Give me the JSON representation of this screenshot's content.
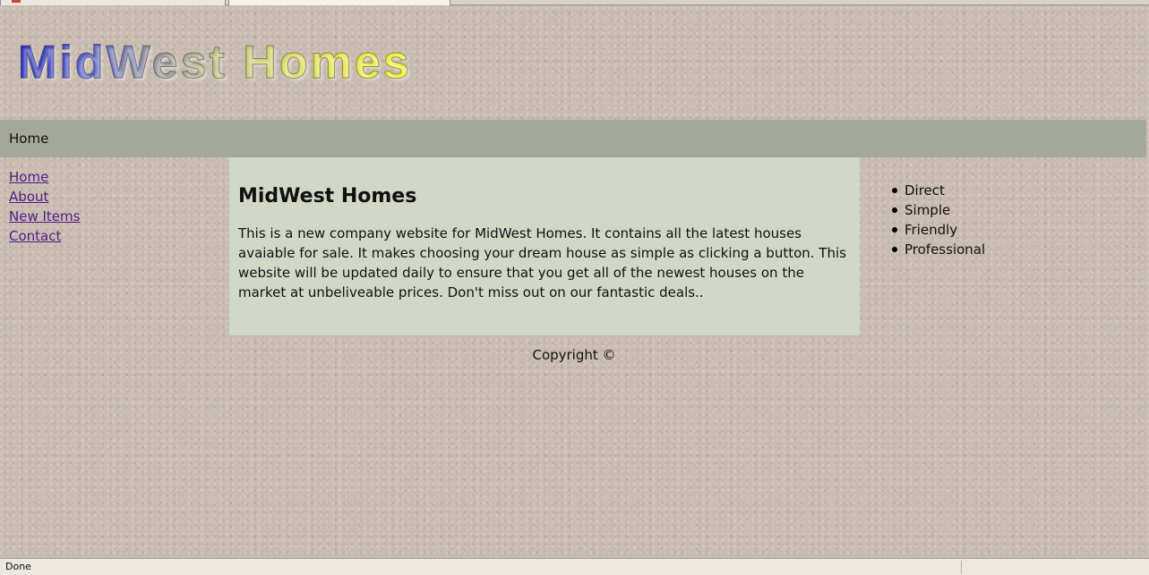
{
  "site": {
    "logo_text": "MidWest Homes"
  },
  "navbar": {
    "title": "Home"
  },
  "left_nav": {
    "items": [
      "Home",
      "About",
      "New Items",
      "Contact"
    ]
  },
  "main": {
    "heading": "MidWest Homes",
    "body": "This is a new company website for MidWest Homes. It contains all the latest houses avaiable for sale. It makes choosing your dream house as simple as clicking a button. This website will be updated daily to ensure that you get all of the newest houses on the market at unbeliveable prices. Don't miss out on our fantastic deals.."
  },
  "right_list": {
    "items": [
      "Direct",
      "Simple",
      "Friendly",
      "Professional"
    ]
  },
  "footer": {
    "copyright": "Copyright ©"
  },
  "status_bar": {
    "text": "Done"
  }
}
